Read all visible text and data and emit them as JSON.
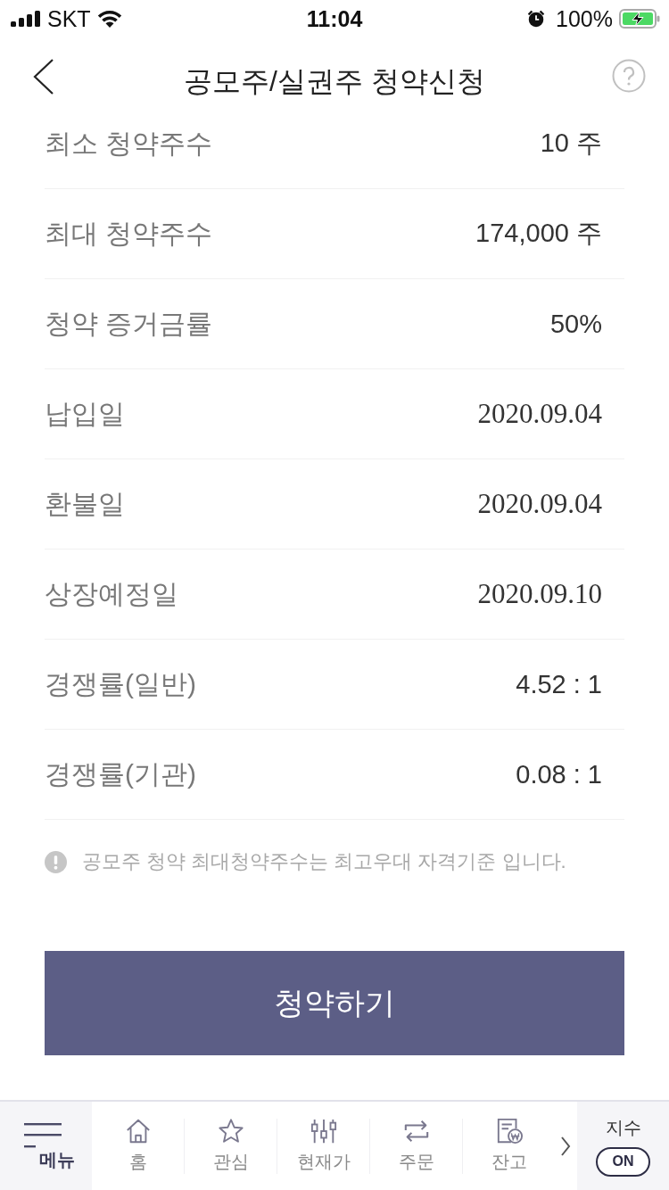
{
  "status_bar": {
    "carrier": "SKT",
    "time": "11:04",
    "battery": "100%"
  },
  "header": {
    "title": "공모주/실권주 청약신청"
  },
  "details": [
    {
      "label": "최소 청약주수",
      "value": "10 주",
      "kind": "text"
    },
    {
      "label": "최대 청약주수",
      "value": "174,000 주",
      "kind": "text"
    },
    {
      "label": "청약 증거금률",
      "value": "50%",
      "kind": "text"
    },
    {
      "label": "납입일",
      "value": "2020.09.04",
      "kind": "date"
    },
    {
      "label": "환불일",
      "value": "2020.09.04",
      "kind": "date"
    },
    {
      "label": "상장예정일",
      "value": "2020.09.10",
      "kind": "date"
    },
    {
      "label": "경쟁률(일반)",
      "value": "4.52 : 1",
      "kind": "text"
    },
    {
      "label": "경쟁률(기관)",
      "value": "0.08 : 1",
      "kind": "text"
    }
  ],
  "notice": "공모주 청약 최대청약주수는 최고우대 자격기준 입니다.",
  "submit_button": "청약하기",
  "tab_bar": {
    "menu": "메뉴",
    "items": [
      {
        "label": "홈",
        "selected": false
      },
      {
        "label": "관심",
        "selected": false
      },
      {
        "label": "현재가",
        "selected": false
      },
      {
        "label": "주문",
        "selected": false
      },
      {
        "label": "잔고",
        "selected": false
      }
    ],
    "index_label": "지수",
    "index_toggle": "ON"
  }
}
